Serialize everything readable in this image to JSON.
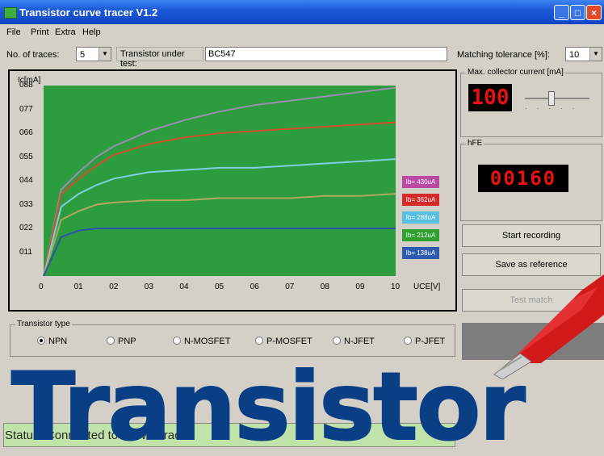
{
  "window": {
    "title": "Transistor curve tracer V1.2"
  },
  "menu": [
    "File",
    "Print",
    "Extra",
    "Help"
  ],
  "params": {
    "traces_label": "No. of traces:",
    "traces_value": "5",
    "transistor_label": "Transistor under test:",
    "transistor_value": "BC547",
    "tolerance_label": "Matching tolerance [%]:",
    "tolerance_value": "10"
  },
  "max_current": {
    "title": "Max. collector current [mA]",
    "value": "100",
    "slider_fraction": 0.4
  },
  "hfe": {
    "title": "hFE",
    "value": "00160"
  },
  "buttons": {
    "start": "Start recording",
    "save": "Save as reference",
    "test": "Test match"
  },
  "transistor_type": {
    "title": "Transistor type",
    "options": [
      "NPN",
      "PNP",
      "N-MOSFET",
      "P-MOSFET",
      "N-JFET",
      "P-JFET"
    ],
    "selected": "NPN"
  },
  "status": {
    "text": "Status: Connected to Curve Tracer"
  },
  "headline": "Transistor",
  "colors": {
    "plot_bg": "#2d9c3e",
    "lcd_red": "#e81010",
    "headline": "#0a3f86"
  },
  "chart_data": {
    "type": "line",
    "ylabel": "Ic[mA]",
    "xlabel": "UCE[V]",
    "xlim": [
      0,
      10
    ],
    "ylim": [
      0,
      88
    ],
    "x_ticks": [
      "0",
      "01",
      "02",
      "03",
      "04",
      "05",
      "06",
      "07",
      "08",
      "09",
      "10"
    ],
    "y_ticks": [
      "011",
      "022",
      "033",
      "044",
      "055",
      "066",
      "077",
      "088"
    ],
    "x": [
      0,
      0.5,
      1,
      1.5,
      2,
      3,
      4,
      5,
      6,
      7,
      8,
      9,
      10
    ],
    "series": [
      {
        "name": "Ib= 430uA",
        "color": "#9a8fb0",
        "legend_bg": "#b84aa6",
        "values": [
          0,
          40,
          48,
          55,
          60,
          67,
          72,
          76,
          79,
          81,
          83,
          85,
          87
        ]
      },
      {
        "name": "Ib= 362uA",
        "color": "#d0502e",
        "legend_bg": "#d42a2a",
        "values": [
          0,
          38,
          45,
          51,
          56,
          61,
          64,
          66,
          67,
          68,
          69,
          70,
          71
        ]
      },
      {
        "name": "Ib= 288uA",
        "color": "#7fd0e0",
        "legend_bg": "#55c0e0",
        "values": [
          0,
          32,
          38,
          42,
          45,
          48,
          49,
          50,
          50,
          51,
          52,
          53,
          54
        ]
      },
      {
        "name": "Ib= 212uA",
        "color": "#b0a860",
        "legend_bg": "#2fa02f",
        "values": [
          0,
          26,
          30,
          33,
          34,
          35,
          35,
          36,
          36,
          36,
          37,
          37,
          38
        ]
      },
      {
        "name": "Ib= 138uA",
        "color": "#2a52a8",
        "legend_bg": "#2d5bb0",
        "values": [
          0,
          18,
          21,
          22,
          22,
          22,
          22,
          22,
          22,
          22,
          22,
          22,
          22
        ]
      }
    ]
  }
}
